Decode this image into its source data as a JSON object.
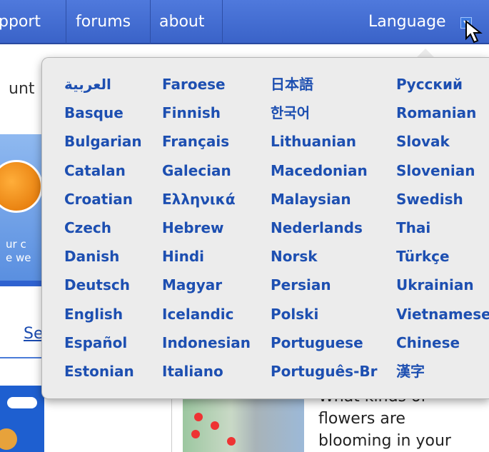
{
  "nav": {
    "items": [
      "pport",
      "forums",
      "about"
    ],
    "language_label": "Language"
  },
  "background": {
    "left_text_unt": "unt",
    "left_text_urc": "ur c",
    "left_text_ewe": "e we",
    "left_link": "Se",
    "story_text": "What kinds of flowers are blooming in your"
  },
  "languages": {
    "col1": [
      "العربية",
      "Basque",
      "Bulgarian",
      "Catalan",
      "Croatian",
      "Czech",
      "Danish",
      "Deutsch",
      "English",
      "Español",
      "Estonian"
    ],
    "col2": [
      "Faroese",
      "Finnish",
      "Français",
      "Galecian",
      "Ελληνικά",
      "Hebrew",
      "Hindi",
      "Magyar",
      "Icelandic",
      "Indonesian",
      "Italiano"
    ],
    "col3": [
      "日本語",
      "한국어",
      "Lithuanian",
      "Macedonian",
      "Malaysian",
      "Nederlands",
      "Norsk",
      "Persian",
      "Polski",
      "Portuguese",
      "Português-Br"
    ],
    "col4": [
      "Русский",
      "Romanian",
      "Slovak",
      "Slovenian",
      "Swedish",
      "Thai",
      "Türkçe",
      "Ukrainian",
      "Vietnamese",
      "Chinese",
      "漢字"
    ]
  },
  "colors": {
    "nav_bg": "#3a63c8",
    "link": "#1d4fb1",
    "dropdown_bg": "#ececec"
  }
}
